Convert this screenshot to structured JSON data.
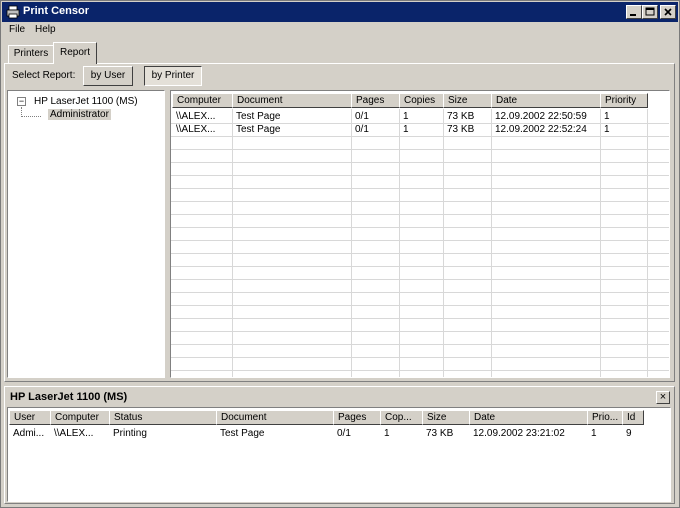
{
  "window": {
    "title": "Print Censor",
    "icon": "printer-app-icon"
  },
  "menu": {
    "items": [
      "File",
      "Help"
    ]
  },
  "tabs": [
    {
      "label": "Printers",
      "active": false
    },
    {
      "label": "Report",
      "active": true
    }
  ],
  "report_toolbar": {
    "label": "Select Report:",
    "by_user": "by User",
    "by_printer": "by Printer",
    "selected": "by Printer"
  },
  "tree": {
    "expander": "−",
    "printer": "HP LaserJet 1100 (MS)",
    "children": [
      "Administrator"
    ],
    "selected": "Administrator"
  },
  "report_table": {
    "columns": [
      "Computer",
      "Document",
      "Pages",
      "Copies",
      "Size",
      "Date",
      "Priority"
    ],
    "rows": [
      [
        "\\\\ALEX...",
        "Test Page",
        "0/1",
        "1",
        "73 KB",
        "12.09.2002 22:50:59",
        "1"
      ],
      [
        "\\\\ALEX...",
        "Test Page",
        "0/1",
        "1",
        "73 KB",
        "12.09.2002 22:52:24",
        "1"
      ]
    ]
  },
  "bottom_panel": {
    "title": "HP LaserJet 1100 (MS)",
    "close": "×",
    "columns": [
      "User",
      "Computer",
      "Status",
      "Document",
      "Pages",
      "Cop...",
      "Size",
      "Date",
      "Prio...",
      "Id"
    ],
    "rows": [
      [
        "Admi...",
        "\\\\ALEX...",
        "Printing",
        "Test Page",
        "0/1",
        "1",
        "73 KB",
        "12.09.2002 23:21:02",
        "1",
        "9"
      ]
    ]
  },
  "colors": {
    "title_bar": "#0a246a",
    "face": "#d4d0c8",
    "grid_line": "#d8d8d8"
  }
}
